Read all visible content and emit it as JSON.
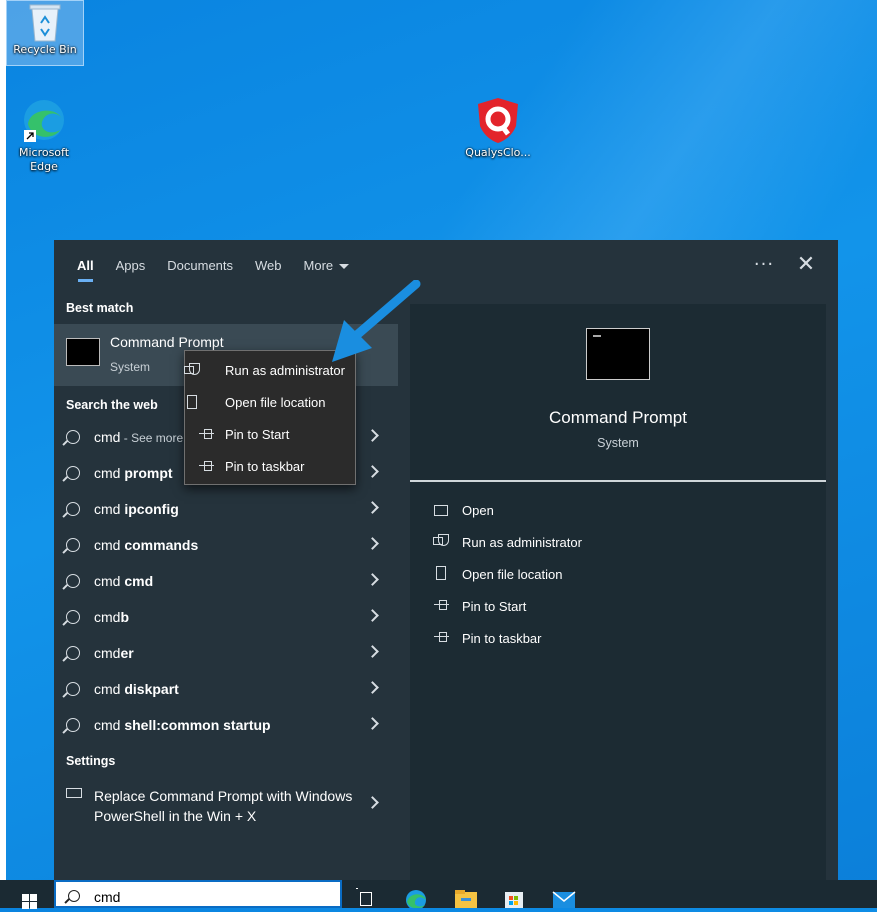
{
  "desktop": {
    "icons": [
      {
        "label": "Recycle Bin",
        "icon": "recycle-bin-icon"
      },
      {
        "label": "Microsoft Edge",
        "icon": "edge-icon"
      },
      {
        "label": "QualysClo...",
        "icon": "qualys-icon"
      }
    ]
  },
  "search_panel": {
    "tabs": [
      {
        "label": "All",
        "active": true
      },
      {
        "label": "Apps"
      },
      {
        "label": "Documents"
      },
      {
        "label": "Web"
      },
      {
        "label": "More"
      }
    ],
    "more_options": "···",
    "close": "✕",
    "best_match_label": "Best match",
    "best_match": {
      "name": "Command Prompt",
      "type": "System"
    },
    "search_web_label": "Search the web",
    "web_results": [
      {
        "prefix": "cmd",
        "bold": "",
        "suffix": " - See more"
      },
      {
        "prefix": "cmd ",
        "bold": "prompt",
        "suffix": ""
      },
      {
        "prefix": "cmd ",
        "bold": "ipconfig",
        "suffix": ""
      },
      {
        "prefix": "cmd ",
        "bold": "commands",
        "suffix": ""
      },
      {
        "prefix": "cmd ",
        "bold": "cmd",
        "suffix": ""
      },
      {
        "prefix": "cmd",
        "bold": "b",
        "suffix": ""
      },
      {
        "prefix": "cmd",
        "bold": "er",
        "suffix": ""
      },
      {
        "prefix": "cmd ",
        "bold": "diskpart",
        "suffix": ""
      },
      {
        "prefix": "cmd ",
        "bold": "shell:common startup",
        "suffix": ""
      }
    ],
    "settings_label": "Settings",
    "settings_item": "Replace Command Prompt with Windows PowerShell in the Win + X",
    "preview": {
      "title": "Command Prompt",
      "subtitle": "System",
      "actions": [
        "Open",
        "Run as administrator",
        "Open file location",
        "Pin to Start",
        "Pin to taskbar"
      ]
    }
  },
  "context_menu": {
    "items": [
      "Run as administrator",
      "Open file location",
      "Pin to Start",
      "Pin to taskbar"
    ]
  },
  "taskbar": {
    "search_value": "cmd"
  },
  "colors": {
    "panel": "#25333c",
    "preview": "#1c2b33",
    "arrow": "#1a8ee0",
    "accent": "#6ab0f3"
  }
}
